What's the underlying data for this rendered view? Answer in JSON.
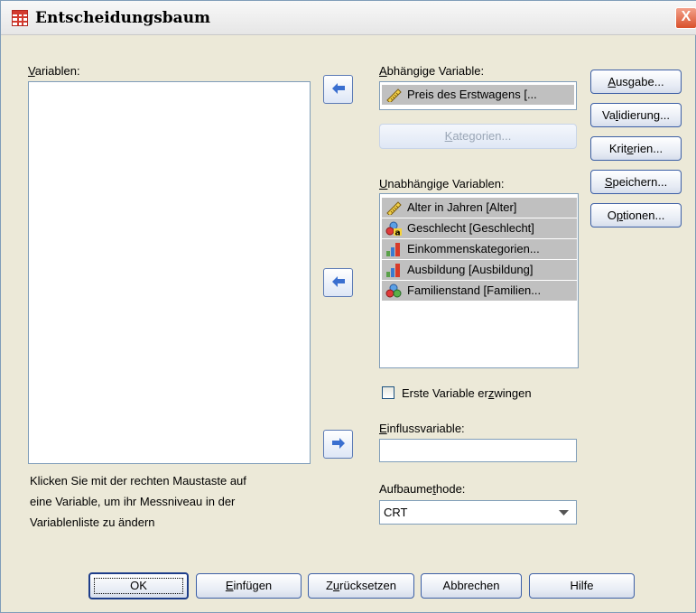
{
  "window": {
    "title": "Entscheidungsbaum",
    "close": "X"
  },
  "variables": {
    "label": "Variablen:",
    "hint_lines": [
      "Klicken Sie mit der rechten Maustaste auf",
      "eine Variable, um ihr Messniveau in der",
      "Variablenliste zu ändern"
    ]
  },
  "dependent": {
    "label": "Abhängige Variable:",
    "value": "Preis des Erstwagens [...",
    "icon": "scale-ruler-icon",
    "categories_label": "Kategorien..."
  },
  "independent": {
    "label": "Unabhängige Variablen:",
    "items": [
      {
        "label": "Alter in Jahren [Alter]",
        "icon": "scale-ruler-icon"
      },
      {
        "label": "Geschlecht [Geschlecht]",
        "icon": "nominal-string-icon"
      },
      {
        "label": "Einkommenskategorien...",
        "icon": "ordinal-bars-icon"
      },
      {
        "label": "Ausbildung [Ausbildung]",
        "icon": "ordinal-bars-icon"
      },
      {
        "label": "Familienstand [Familien...",
        "icon": "nominal-circles-icon"
      }
    ]
  },
  "force_first": {
    "label": "Erste Variable erzwingen",
    "checked": false
  },
  "influence": {
    "label": "Einflussvariable:",
    "value": ""
  },
  "method": {
    "label": "Aufbaumethode:",
    "selected": "CRT"
  },
  "side_buttons": [
    "Ausgabe...",
    "Validierung...",
    "Kriterien...",
    "Speichern...",
    "Optionen..."
  ],
  "bottom_buttons": [
    "OK",
    "Einfügen",
    "Zurücksetzen",
    "Abbrechen",
    "Hilfe"
  ],
  "colors": {
    "dialog_bg": "#ece9d8",
    "selection": "#c0c0c0",
    "button_border": "#3c5fa6",
    "arrow_blue": "#3a6fd0"
  }
}
